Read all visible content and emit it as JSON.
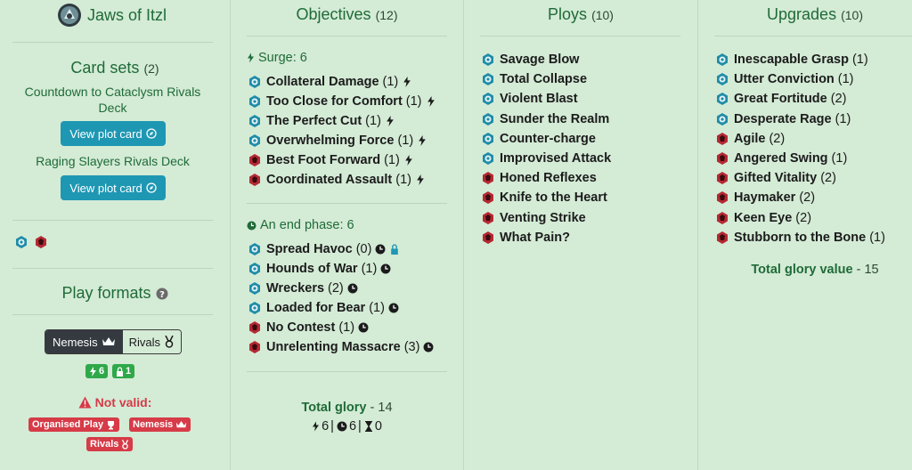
{
  "sidebar": {
    "warband_name": "Jaws of Itzl",
    "card_sets_title": "Card sets",
    "card_sets_count": "(2)",
    "sets": [
      {
        "name": "Countdown to Cataclysm Rivals Deck",
        "button": "View plot card"
      },
      {
        "name": "Raging Slayers Rivals Deck",
        "button": "View plot card"
      }
    ],
    "play_formats_title": "Play formats",
    "toggle": {
      "nemesis": "Nemesis",
      "rivals": "Rivals",
      "selected": "Nemesis"
    },
    "stats_badges": [
      {
        "icon": "surge-icon",
        "value": "6"
      },
      {
        "icon": "lock-icon",
        "value": "1"
      }
    ],
    "not_valid_label": "Not valid:",
    "invalid_formats": [
      "Organised Play",
      "Nemesis",
      "Rivals"
    ]
  },
  "objectives": {
    "title": "Objectives",
    "count": "(12)",
    "surge_group": {
      "label": "Surge: 6",
      "cards": [
        {
          "name": "Collateral Damage",
          "glory": "(1)",
          "set": "teal",
          "tags": [
            "surge"
          ]
        },
        {
          "name": "Too Close for Comfort",
          "glory": "(1)",
          "set": "teal",
          "tags": [
            "surge"
          ]
        },
        {
          "name": "The Perfect Cut",
          "glory": "(1)",
          "set": "teal",
          "tags": [
            "surge"
          ]
        },
        {
          "name": "Overwhelming Force",
          "glory": "(1)",
          "set": "teal",
          "tags": [
            "surge"
          ]
        },
        {
          "name": "Best Foot Forward",
          "glory": "(1)",
          "set": "red",
          "tags": [
            "surge"
          ]
        },
        {
          "name": "Coordinated Assault",
          "glory": "(1)",
          "set": "red",
          "tags": [
            "surge"
          ]
        }
      ]
    },
    "end_group": {
      "label": "An end phase: 6",
      "cards": [
        {
          "name": "Spread Havoc",
          "glory": "(0)",
          "set": "teal",
          "tags": [
            "clock",
            "lock"
          ]
        },
        {
          "name": "Hounds of War",
          "glory": "(1)",
          "set": "teal",
          "tags": [
            "clock"
          ]
        },
        {
          "name": "Wreckers",
          "glory": "(2)",
          "set": "teal",
          "tags": [
            "clock"
          ]
        },
        {
          "name": "Loaded for Bear",
          "glory": "(1)",
          "set": "teal",
          "tags": [
            "clock"
          ]
        },
        {
          "name": "No Contest",
          "glory": "(1)",
          "set": "red",
          "tags": [
            "clock"
          ]
        },
        {
          "name": "Unrelenting Massacre",
          "glory": "(3)",
          "set": "red",
          "tags": [
            "clock"
          ]
        }
      ]
    },
    "total_label": "Total glory",
    "total_value": "- 14",
    "summary": [
      {
        "icon": "surge-icon",
        "value": "6"
      },
      {
        "icon": "clock-icon",
        "value": "6"
      },
      {
        "icon": "hourglass-icon",
        "value": "0"
      }
    ],
    "summary_sep": "|"
  },
  "ploys": {
    "title": "Ploys",
    "count": "(10)",
    "cards": [
      {
        "name": "Savage Blow",
        "set": "teal"
      },
      {
        "name": "Total Collapse",
        "set": "teal"
      },
      {
        "name": "Violent Blast",
        "set": "teal"
      },
      {
        "name": "Sunder the Realm",
        "set": "teal"
      },
      {
        "name": "Counter-charge",
        "set": "teal"
      },
      {
        "name": "Improvised Attack",
        "set": "teal"
      },
      {
        "name": "Honed Reflexes",
        "set": "red"
      },
      {
        "name": "Knife to the Heart",
        "set": "red"
      },
      {
        "name": "Venting Strike",
        "set": "red"
      },
      {
        "name": "What Pain?",
        "set": "red"
      }
    ]
  },
  "upgrades": {
    "title": "Upgrades",
    "count": "(10)",
    "cards": [
      {
        "name": "Inescapable Grasp",
        "glory": "(1)",
        "set": "teal"
      },
      {
        "name": "Utter Conviction",
        "glory": "(1)",
        "set": "teal"
      },
      {
        "name": "Great Fortitude",
        "glory": "(2)",
        "set": "teal"
      },
      {
        "name": "Desperate Rage",
        "glory": "(1)",
        "set": "teal"
      },
      {
        "name": "Agile",
        "glory": "(2)",
        "set": "red"
      },
      {
        "name": "Angered Swing",
        "glory": "(1)",
        "set": "red"
      },
      {
        "name": "Gifted Vitality",
        "glory": "(2)",
        "set": "red"
      },
      {
        "name": "Haymaker",
        "glory": "(2)",
        "set": "red"
      },
      {
        "name": "Keen Eye",
        "glory": "(2)",
        "set": "red"
      },
      {
        "name": "Stubborn to the Bone",
        "glory": "(1)",
        "set": "red"
      }
    ],
    "total_label": "Total glory value",
    "total_value": "- 15"
  },
  "colors": {
    "teal_set": "#1e8ca8",
    "red_set": "#b52832",
    "accent": "#1f6b37",
    "button": "#1e97b3"
  }
}
